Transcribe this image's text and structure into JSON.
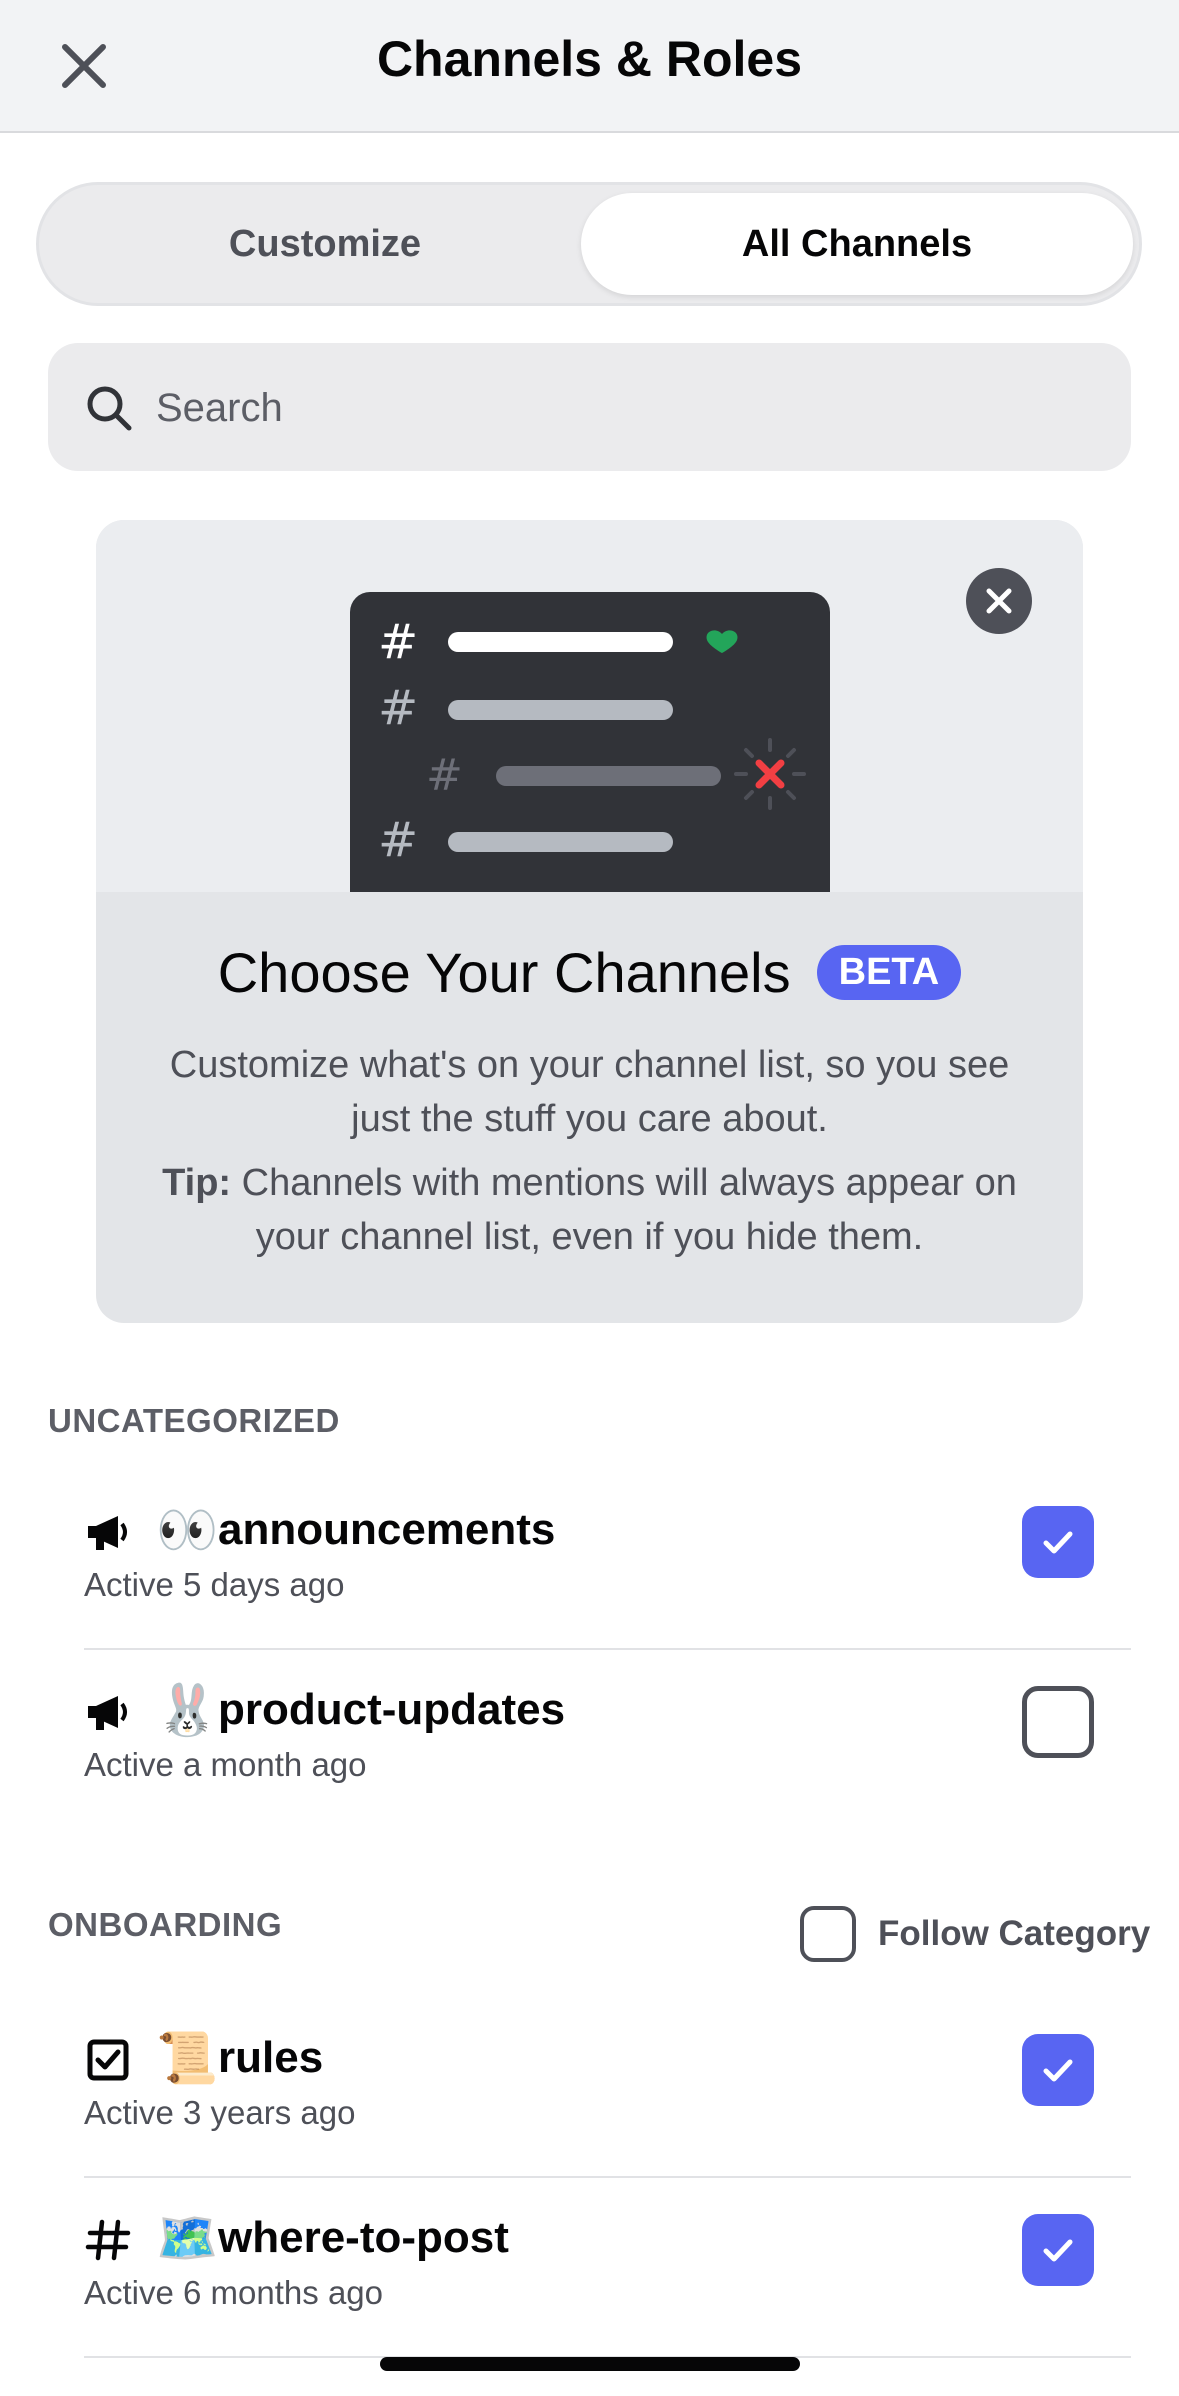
{
  "header": {
    "title": "Channels & Roles"
  },
  "tabs": [
    {
      "label": "Customize",
      "selected": false
    },
    {
      "label": "All Channels",
      "selected": true
    }
  ],
  "search": {
    "placeholder": "Search"
  },
  "banner": {
    "title": "Choose Your Channels",
    "badge": "BETA",
    "description": "Customize what's on your channel list, so you see just the stuff you care about.",
    "tip_label": "Tip:",
    "tip_text": "Channels with mentions will always appear on your channel list, even if you hide them."
  },
  "sections": [
    {
      "title": "UNCATEGORIZED",
      "channels": [
        {
          "icon": "megaphone-icon",
          "emoji": "👀",
          "name": "announcements",
          "activity": "Active 5 days ago",
          "checked": true
        },
        {
          "icon": "megaphone-icon",
          "emoji": "🐰",
          "name": "product-updates",
          "activity": "Active a month ago",
          "checked": false
        }
      ]
    },
    {
      "title": "ONBOARDING",
      "follow_label": "Follow Category",
      "channels": [
        {
          "icon": "rules-icon",
          "emoji": "📜",
          "name": "rules",
          "activity": "Active 3 years ago",
          "checked": true
        },
        {
          "icon": "hash-icon",
          "emoji": "🗺️",
          "name": "where-to-post",
          "activity": "Active 6 months ago",
          "checked": true
        }
      ]
    }
  ],
  "colors": {
    "accent": "#5865f2",
    "green": "#23a55a",
    "red": "#f23f43"
  }
}
